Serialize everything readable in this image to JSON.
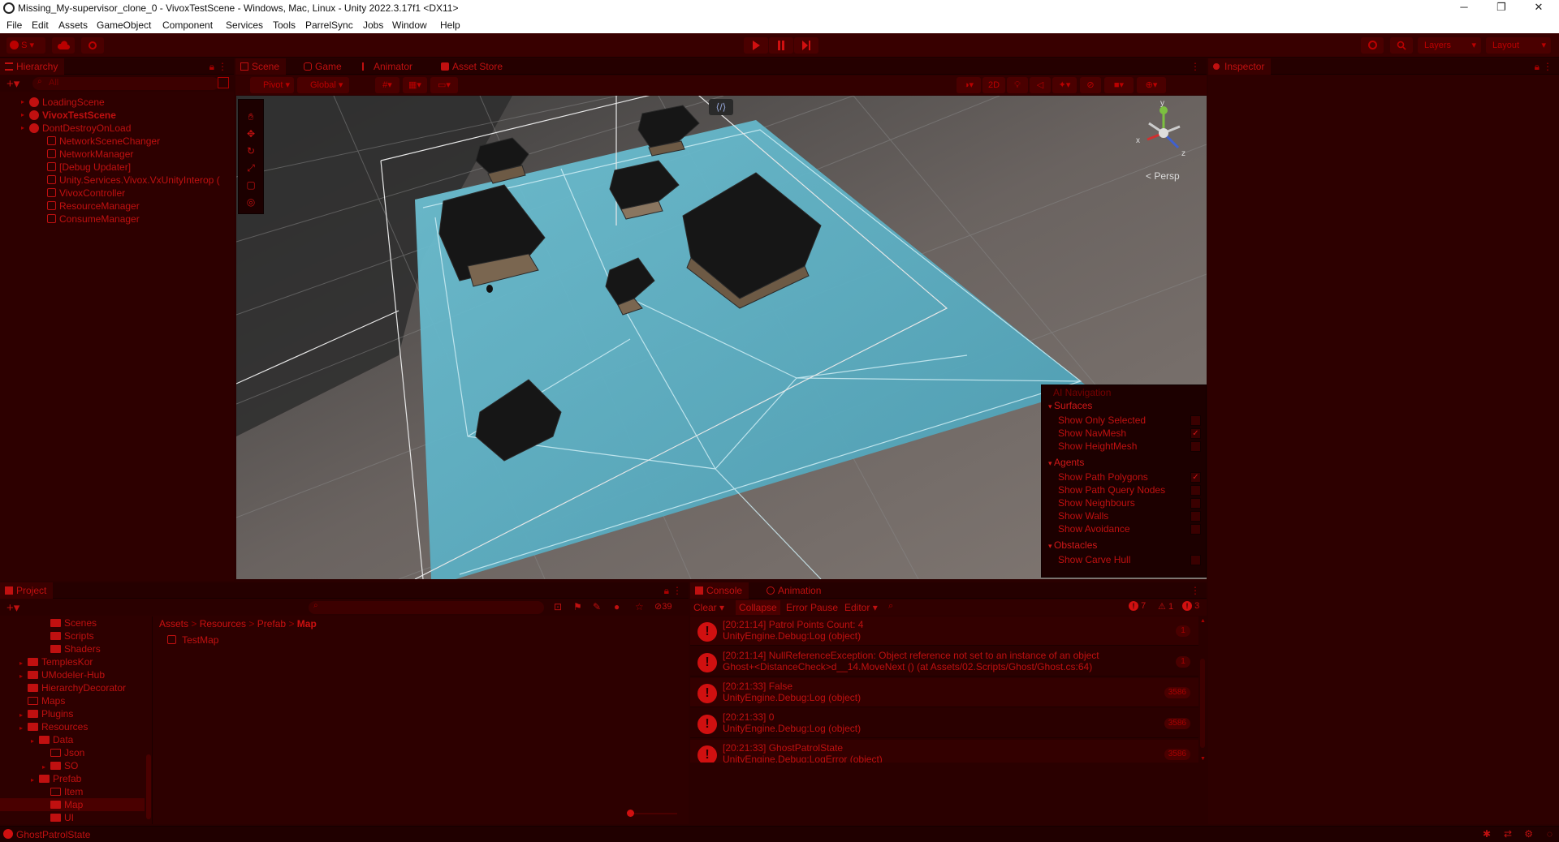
{
  "window": {
    "title": "Missing_My-supervisor_clone_0 - VivoxTestScene - Windows, Mac, Linux - Unity 2022.3.17f1 <DX11>",
    "minimize": "─",
    "maximize": "❐",
    "close": "✕"
  },
  "menu": [
    "File",
    "Edit",
    "Assets",
    "GameObject",
    "Component",
    "Services",
    "Tools",
    "ParrelSync",
    "Jobs",
    "Window",
    "Help"
  ],
  "toolbar": {
    "account": "S",
    "layers": "Layers",
    "layout": "Layout"
  },
  "hierarchy": {
    "tab": "Hierarchy",
    "search_placeholder": "All",
    "items": [
      {
        "label": "LoadingScene",
        "kind": "scene",
        "depth": 0
      },
      {
        "label": "VivoxTestScene",
        "kind": "scene",
        "depth": 0,
        "bold": true
      },
      {
        "label": "DontDestroyOnLoad",
        "kind": "scene",
        "depth": 0
      },
      {
        "label": "NetworkSceneChanger",
        "kind": "object",
        "depth": 1
      },
      {
        "label": "NetworkManager",
        "kind": "object",
        "depth": 1
      },
      {
        "label": "[Debug Updater]",
        "kind": "object",
        "depth": 1
      },
      {
        "label": "Unity.Services.Vivox.VxUnityInterop (",
        "kind": "object",
        "depth": 1
      },
      {
        "label": "VivoxController",
        "kind": "object",
        "depth": 1
      },
      {
        "label": "ResourceManager",
        "kind": "object",
        "depth": 1
      },
      {
        "label": "ConsumeManager",
        "kind": "object",
        "depth": 1
      }
    ]
  },
  "scene_tabs": {
    "scene": "Scene",
    "game": "Game",
    "animator": "Animator",
    "asset_store": "Asset Store"
  },
  "scene_toolbar": {
    "pivot": "Pivot",
    "global": "Global",
    "mode_2d": "2D",
    "persp": "Persp",
    "gizmo_y": "y",
    "gizmo_x": "x",
    "gizmo_z": "z"
  },
  "navigation_overlay": {
    "title": "AI Navigation",
    "sections": [
      {
        "header": "Surfaces",
        "items": [
          {
            "label": "Show Only Selected",
            "checked": false
          },
          {
            "label": "Show NavMesh",
            "checked": true
          },
          {
            "label": "Show HeightMesh",
            "checked": false
          }
        ]
      },
      {
        "header": "Agents",
        "items": [
          {
            "label": "Show Path Polygons",
            "checked": true
          },
          {
            "label": "Show Path Query Nodes",
            "checked": false
          },
          {
            "label": "Show Neighbours",
            "checked": false
          },
          {
            "label": "Show Walls",
            "checked": false
          },
          {
            "label": "Show Avoidance",
            "checked": false
          }
        ]
      },
      {
        "header": "Obstacles",
        "items": [
          {
            "label": "Show Carve Hull",
            "checked": false
          }
        ]
      }
    ]
  },
  "inspector": {
    "tab": "Inspector"
  },
  "project": {
    "tab": "Project",
    "hidden_count": "39",
    "breadcrumb": [
      "Assets",
      "Resources",
      "Prefab",
      "Map"
    ],
    "tree": [
      {
        "label": "Scenes",
        "depth": 3,
        "open": false
      },
      {
        "label": "Scripts",
        "depth": 3,
        "open": false
      },
      {
        "label": "Shaders",
        "depth": 3,
        "open": false
      },
      {
        "label": "TemplesKor",
        "depth": 1,
        "open": false,
        "arrow": true
      },
      {
        "label": "UModeler-Hub",
        "depth": 1,
        "open": false,
        "arrow": true
      },
      {
        "label": "HierarchyDecorator",
        "depth": 1,
        "open": false
      },
      {
        "label": "Maps",
        "depth": 1,
        "open": true
      },
      {
        "label": "Plugins",
        "depth": 1,
        "open": false,
        "arrow": true
      },
      {
        "label": "Resources",
        "depth": 1,
        "open": false,
        "arrow": true
      },
      {
        "label": "Data",
        "depth": 2,
        "open": false,
        "arrow": true
      },
      {
        "label": "Json",
        "depth": 3,
        "open": true
      },
      {
        "label": "SO",
        "depth": 3,
        "open": false,
        "arrow": true
      },
      {
        "label": "Prefab",
        "depth": 2,
        "open": false,
        "arrow": true
      },
      {
        "label": "Item",
        "depth": 3,
        "open": true
      },
      {
        "label": "Map",
        "depth": 3,
        "open": false,
        "selected": true
      },
      {
        "label": "UI",
        "depth": 3,
        "open": false
      }
    ],
    "files": [
      {
        "label": "TestMap"
      }
    ]
  },
  "console": {
    "tab": "Console",
    "tab2": "Animation",
    "clear": "Clear",
    "collapse": "Collapse",
    "error_pause": "Error Pause",
    "editor": "Editor",
    "count_errors_a": "7",
    "count_warnings": "1",
    "count_errors_b": "3",
    "entries": [
      {
        "line1": "[20:21:14] Patrol Points Count: 4",
        "line2": "UnityEngine.Debug:Log (object)",
        "count": "1"
      },
      {
        "line1": "[20:21:14] NullReferenceException: Object reference not set to an instance of an object",
        "line2": "Ghost+<DistanceCheck>d__14.MoveNext () (at Assets/02.Scripts/Ghost/Ghost.cs:64)",
        "count": "1"
      },
      {
        "line1": "[20:21:33] False",
        "line2": "UnityEngine.Debug:Log (object)",
        "count": "3586"
      },
      {
        "line1": "[20:21:33] 0",
        "line2": "UnityEngine.Debug:Log (object)",
        "count": "3586"
      },
      {
        "line1": "[20:21:33] GhostPatrolState",
        "line2": "UnityEngine.Debug:LogError (object)",
        "count": "3586"
      }
    ]
  },
  "status": {
    "message": "GhostPatrolState"
  },
  "colors": {
    "accent": "#c01010",
    "panel_bg": "#2d0000",
    "navmesh": "#5fb6cc"
  }
}
